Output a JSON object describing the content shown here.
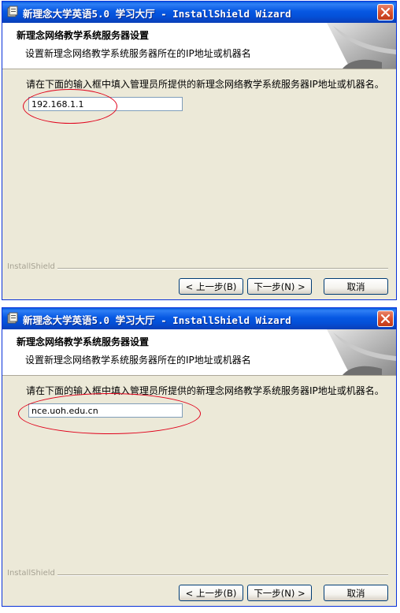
{
  "windows": [
    {
      "title": "新理念大学英语5.0 学习大厅 - InstallShield Wizard",
      "banner_title": "新理念网络教学系统服务器设置",
      "banner_subtitle": "设置新理念网络教学系统服务器所在的IP地址或机器名",
      "instruction": "请在下面的输入框中填入管理员所提供的新理念网络教学系统服务器IP地址或机器名。",
      "server_value": "192.168.1.1",
      "brand": "InstallShield",
      "back_label": "< 上一步(B)",
      "next_label": "下一步(N) >",
      "cancel_label": "取消"
    },
    {
      "title": "新理念大学英语5.0 学习大厅 - InstallShield Wizard",
      "banner_title": "新理念网络教学系统服务器设置",
      "banner_subtitle": "设置新理念网络教学系统服务器所在的IP地址或机器名",
      "instruction": "请在下面的输入框中填入管理员所提供的新理念网络教学系统服务器IP地址或机器名。",
      "server_value": "nce.uoh.edu.cn",
      "brand": "InstallShield",
      "back_label": "< 上一步(B)",
      "next_label": "下一步(N) >",
      "cancel_label": "取消"
    }
  ],
  "icons": {
    "title": "installer-icon",
    "close": "close-icon",
    "banner": "page-curl-graphic"
  },
  "colors": {
    "titlebar": "#0450d8",
    "dialog_background": "#ece9d8",
    "highlight_ellipse": "#e0001a",
    "close_button": "#d8512f"
  }
}
